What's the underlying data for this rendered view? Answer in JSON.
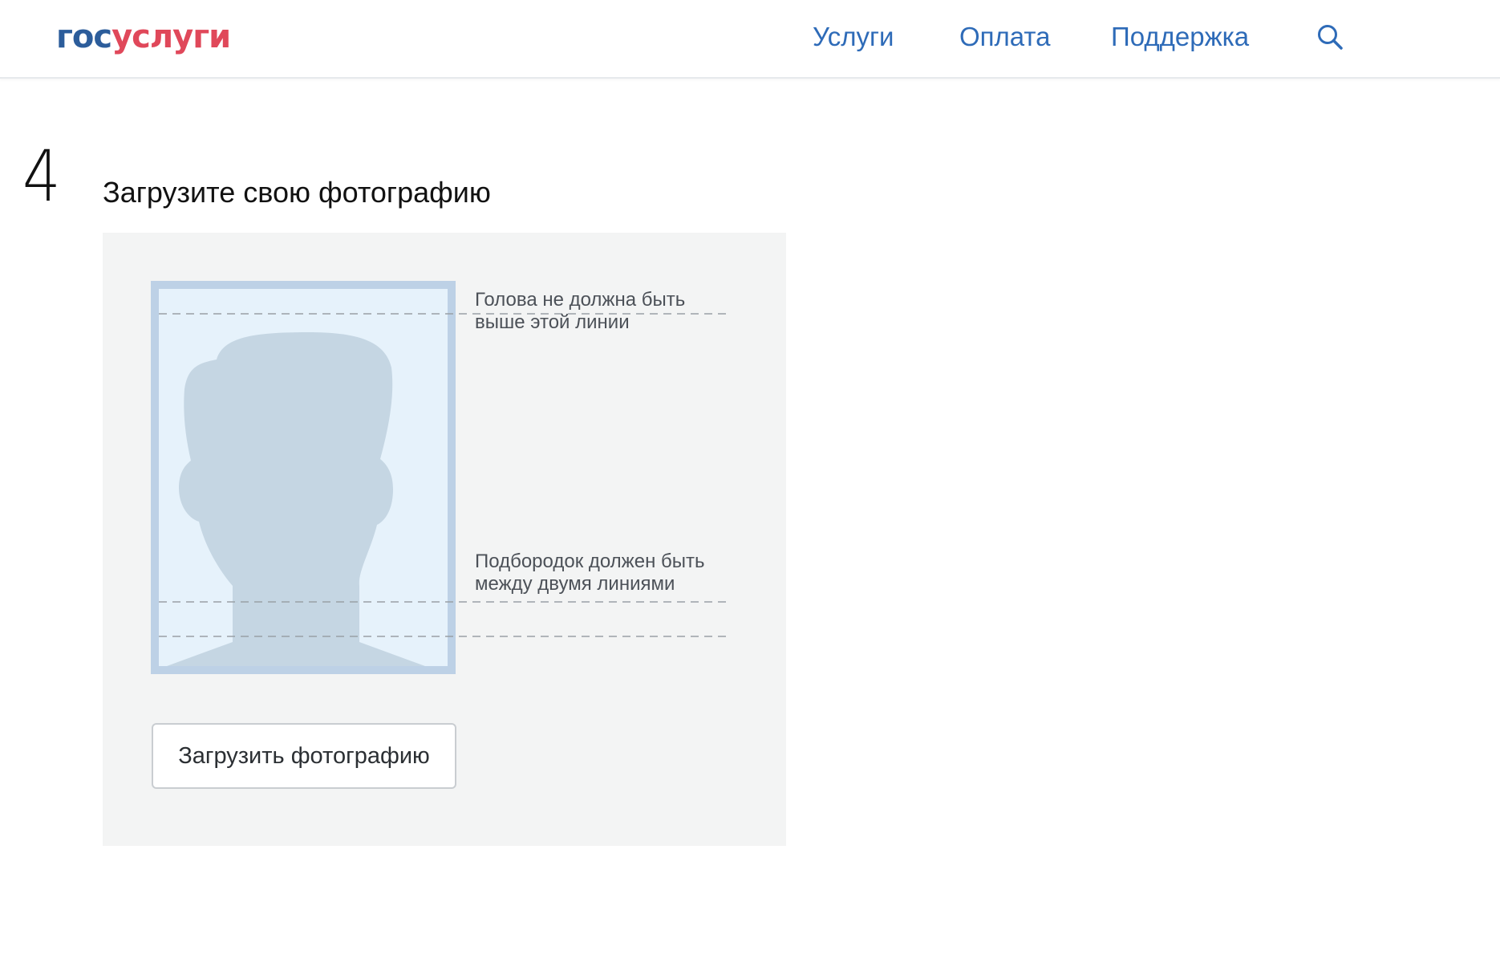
{
  "header": {
    "logo": {
      "part1": "гос",
      "part2": "услуги"
    },
    "nav": [
      {
        "label": "Услуги"
      },
      {
        "label": "Оплата"
      },
      {
        "label": "Поддержка"
      }
    ],
    "search_icon": "search-icon"
  },
  "step": {
    "number": "4",
    "title": "Загрузите свою фотографию"
  },
  "photo_guide": {
    "hint_head": "Голова не должна быть выше этой линии",
    "hint_chin": "Подбородок должен быть между двумя линиями",
    "silhouette_icon": "person-silhouette-icon"
  },
  "upload_button": {
    "label": "Загрузить фотографию"
  },
  "colors": {
    "brand_blue": "#2c5d9b",
    "brand_red": "#e0485a",
    "link_blue": "#2e6bb8",
    "panel_bg": "#f3f4f4",
    "frame": "#bdd1e6",
    "photo_bg": "#e6f2fb",
    "silhouette": "#c5d6e3"
  }
}
